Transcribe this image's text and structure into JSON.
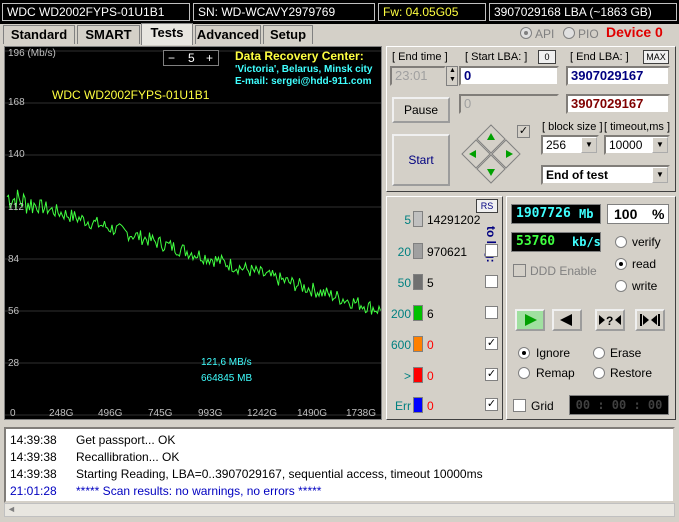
{
  "info": {
    "model": "WDC WD2002FYPS-01U1B1",
    "serial": "SN: WD-WCAVY2979769",
    "firmware": "Fw: 04.05G05",
    "capacity": "3907029168 LBA (~1863 GB)"
  },
  "tabs": [
    "Standard",
    "SMART",
    "Tests",
    "Advanced",
    "Setup"
  ],
  "active_tab": "Tests",
  "mode": {
    "api_label": "API",
    "pio_label": "PIO",
    "selected": "API"
  },
  "device_label": "Device 0",
  "graph": {
    "y_unit": "(Mb/s)",
    "y_ticks": [
      "196",
      "168",
      "140",
      "112",
      "84",
      "56",
      "28"
    ],
    "x_ticks": [
      "0",
      "248G",
      "496G",
      "745G",
      "993G",
      "1242G",
      "1490G",
      "1738G"
    ],
    "model_label": "WDC WD2002FYPS-01U1B1",
    "spinner_value": "5",
    "spinner_minus": "−",
    "spinner_plus": "+",
    "recovery_title": "Data Recovery Center:",
    "recovery_place": "'Victoria', Belarus, Minsk city",
    "recovery_email": "E-mail: sergei@hdd-911.com",
    "current_speed": "121,6 MB/s",
    "current_pos": "664845 MB",
    "line_color": "#40ff40"
  },
  "controls": {
    "end_time_label": "[ End time ]",
    "end_time_value": "23:01",
    "start_lba_label": "[ Start LBA: ]",
    "start_lba_btn": "0",
    "end_lba_label": "[ End LBA: ]",
    "end_lba_btn": "MAX",
    "start_lba_value": "0",
    "end_lba_value": "3907029167",
    "cur_lba_value": "0",
    "cur_end_lba_value": "3907029167",
    "pause_label": "Pause",
    "start_label": "Start",
    "block_size_label": "[ block size ]",
    "block_size_value": "256",
    "timeout_label": "[ timeout,ms ]",
    "timeout_value": "10000",
    "end_action_value": "End of test"
  },
  "counts": {
    "rs_label": "RS",
    "to_log_label": "to log:",
    "rows": [
      {
        "label": "5",
        "value": "14291202",
        "color": "#c0c0c0",
        "checked": false
      },
      {
        "label": "20",
        "value": "970621",
        "color": "#a0a0a0",
        "checked": false
      },
      {
        "label": "50",
        "value": "5",
        "color": "#707070",
        "checked": false
      },
      {
        "label": "200",
        "value": "6",
        "color": "#00c000",
        "checked": false
      },
      {
        "label": "600",
        "value": "0",
        "color": "#ff8000",
        "checked": true
      },
      {
        "label": ">",
        "value": "0",
        "color": "#ff0000",
        "checked": true
      },
      {
        "label": "Err",
        "value": "0",
        "color": "#0000ff",
        "checked": true
      }
    ]
  },
  "stats": {
    "mb_value": "1907726",
    "mb_unit": "Mb",
    "percent": "100",
    "percent_unit": "%",
    "speed_value": "53760",
    "speed_unit": "kb/s",
    "ddd_label": "DDD Enable",
    "verify_label": "verify",
    "read_label": "read",
    "write_label": "write",
    "selected_mode": "read",
    "play_icon": "play-icon",
    "rewind_icon": "rewind-icon",
    "skip_icon": "skip-icon",
    "end_icon": "end-icon"
  },
  "actions": {
    "ignore_label": "Ignore",
    "erase_label": "Erase",
    "remap_label": "Remap",
    "restore_label": "Restore",
    "selected": "Ignore",
    "grid_label": "Grid",
    "timer": "00 : 00 : 00"
  },
  "log": [
    {
      "time": "14:39:38",
      "text": "Get passport... OK",
      "color": "#000000"
    },
    {
      "time": "14:39:38",
      "text": "Recallibration... OK",
      "color": "#000000"
    },
    {
      "time": "14:39:38",
      "text": "Starting Reading, LBA=0..3907029167, sequential access, timeout 10000ms",
      "color": "#000000"
    },
    {
      "time": "21:01:28",
      "text": "***** Scan results: no warnings, no errors *****",
      "color": "#0000c0"
    }
  ]
}
